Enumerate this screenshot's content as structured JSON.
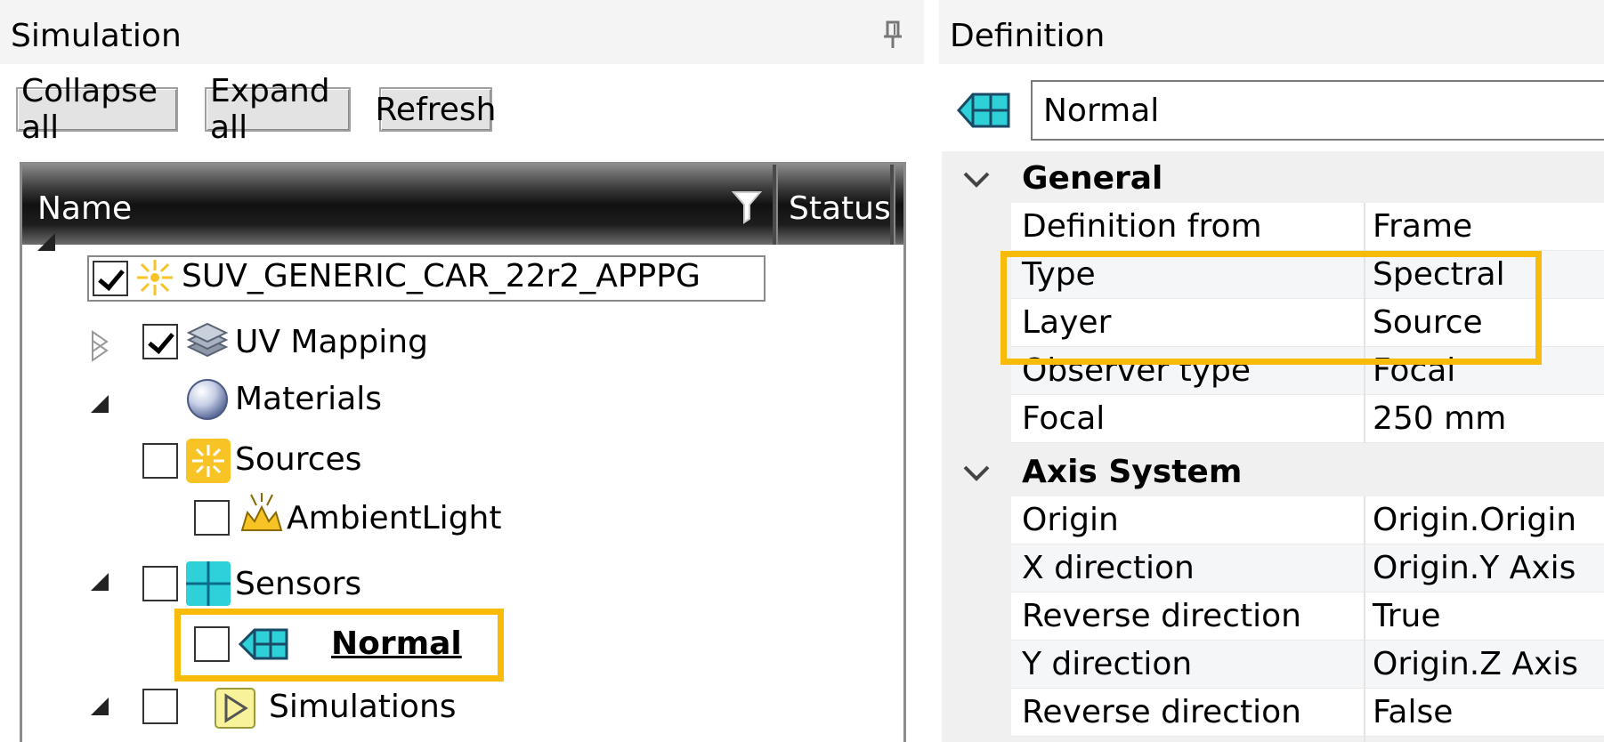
{
  "simulation_panel": {
    "title": "Simulation",
    "buttons": {
      "collapse_all": "Collapse all",
      "expand_all": "Expand all",
      "refresh": "Refresh"
    },
    "columns": {
      "name": "Name",
      "status": "Status"
    },
    "tree": {
      "root": {
        "label": "SUV_GENERIC_CAR_22r2_APPPG",
        "checked": true,
        "expanded": true
      },
      "uv_mapping": {
        "label": "UV Mapping",
        "checked": true,
        "expanded": false
      },
      "materials": {
        "label": "Materials",
        "expanded": false
      },
      "sources": {
        "label": "Sources",
        "checked": false,
        "expanded": true
      },
      "ambient_light": {
        "label": "AmbientLight",
        "checked": false
      },
      "sensors": {
        "label": "Sensors",
        "checked": false,
        "expanded": true
      },
      "normal": {
        "label": "Normal",
        "checked": false,
        "selected": true
      },
      "simulations": {
        "label": "Simulations",
        "checked": false,
        "expanded": true
      }
    }
  },
  "definition_panel": {
    "title": "Definition",
    "name_value": "Normal",
    "sections": [
      {
        "title": "General",
        "properties": [
          {
            "name": "Definition from",
            "value": "Frame"
          },
          {
            "name": "Type",
            "value": "Spectral"
          },
          {
            "name": "Layer",
            "value": "Source"
          },
          {
            "name": "Observer type",
            "value": "Focal"
          },
          {
            "name": "Focal",
            "value": "250 mm"
          }
        ]
      },
      {
        "title": "Axis System",
        "properties": [
          {
            "name": "Origin",
            "value": "Origin.Origin"
          },
          {
            "name": "X direction",
            "value": "Origin.Y Axis"
          },
          {
            "name": "Reverse direction",
            "value": "True"
          },
          {
            "name": "Y direction",
            "value": "Origin.Z Axis"
          },
          {
            "name": "Reverse direction",
            "value": "False"
          }
        ]
      }
    ]
  },
  "colors": {
    "highlight": "#F9BB09",
    "sensor": "#2ED1D8",
    "source": "#F7C325"
  }
}
